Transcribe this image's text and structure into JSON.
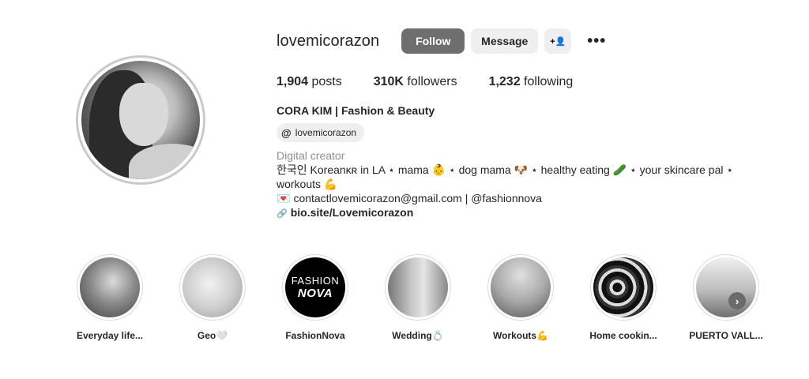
{
  "profile": {
    "username": "lovemicorazon",
    "full_name": "CORA KIM | Fashion & Beauty",
    "threads_handle": "lovemicorazon",
    "category": "Digital creator"
  },
  "actions": {
    "follow_label": "Follow",
    "message_label": "Message",
    "add_user_icon": "+👤",
    "more_label": "•••"
  },
  "stats": {
    "posts_count": "1,904",
    "posts_label": " posts",
    "followers_count": "310K",
    "followers_label": " followers",
    "following_count": "1,232",
    "following_label": " following"
  },
  "bio": {
    "line1": "한국인 Koreanᴋʀ in LA ⋆ mama 👶 ⋆ dog mama 🐶 ⋆ healthy eating 🥒 ⋆ your skincare pal ⋆",
    "line2": "workouts 💪",
    "email_line": "contactlovemicorazon@gmail.com | @fashionnova",
    "email_icon": "💌",
    "link_icon": "🔗",
    "link": "bio.site/Lovemicorazon"
  },
  "highlights": [
    {
      "label": "Everyday life..."
    },
    {
      "label": "Geo🤍"
    },
    {
      "label": "FashionNova",
      "cover_top": "FASHION",
      "cover_bottom": "NOVA"
    },
    {
      "label": "Wedding💍"
    },
    {
      "label": "Workouts💪"
    },
    {
      "label": "Home cookin..."
    },
    {
      "label": "PUERTO VALL..."
    }
  ],
  "next_arrow": "›"
}
